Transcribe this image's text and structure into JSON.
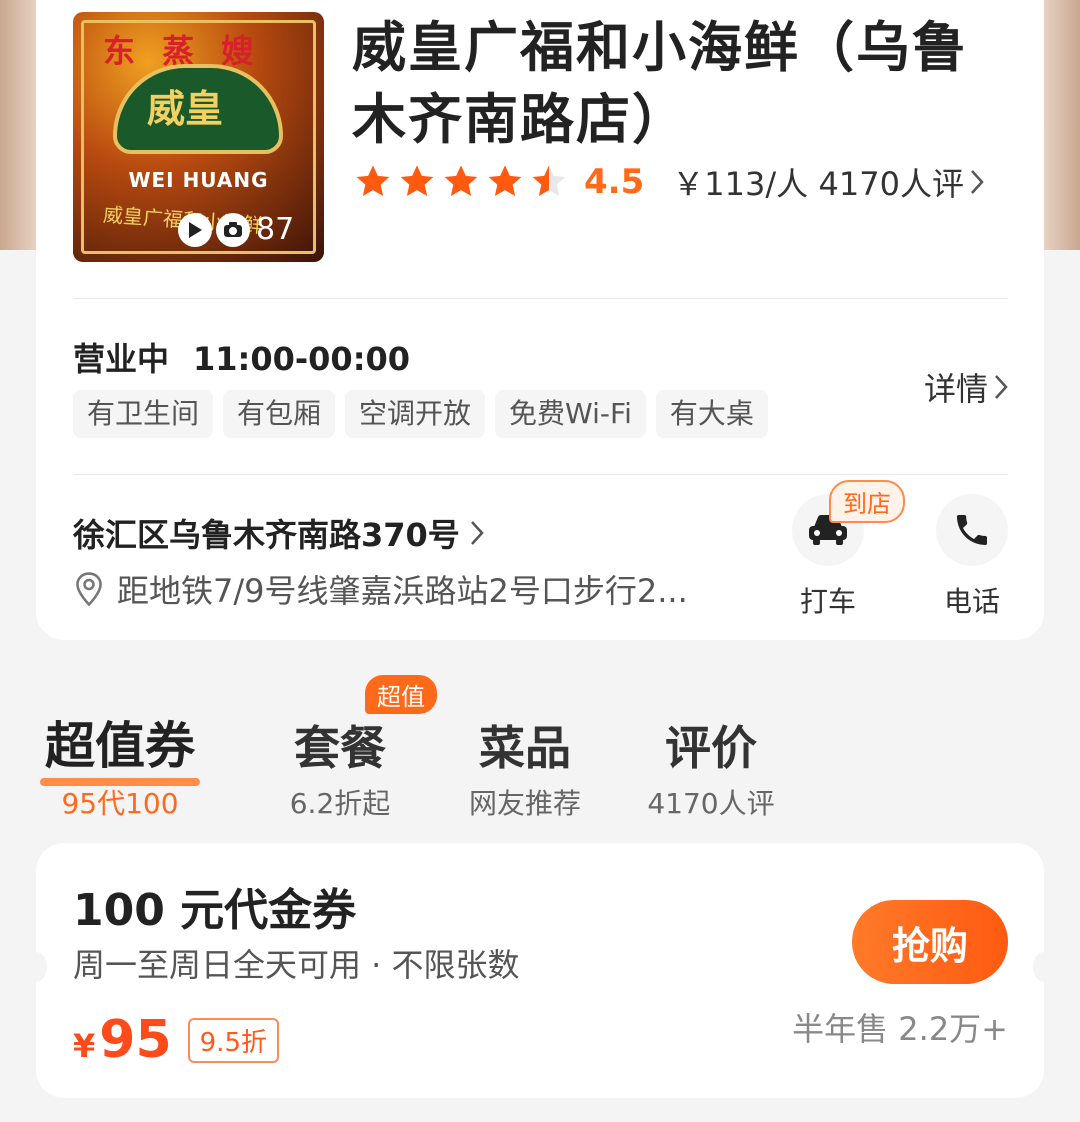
{
  "shop": {
    "cover": {
      "top_text": "东 蒸 嫂",
      "logo_text": "威皇",
      "logo_en": "WEI HUANG",
      "logo_sub": "威皇广福和小海鲜",
      "media_count": "87"
    },
    "title": "威皇广福和小海鲜（乌鲁木齐南路店）",
    "rating": 4.5,
    "rating_text": "4.5",
    "price_per_person": "￥113/人",
    "review_count": "4170人评"
  },
  "business": {
    "status": "营业中",
    "hours": "11:00-00:00",
    "tags": [
      "有卫生间",
      "有包厢",
      "空调开放",
      "免费Wi-Fi",
      "有大桌"
    ],
    "details_label": "详情"
  },
  "location": {
    "address": "徐汇区乌鲁木齐南路370号",
    "subway": "距地铁7/9号线肇嘉浜路站2号口步行2...",
    "taxi_badge": "到店",
    "taxi_label": "打车",
    "phone_label": "电话"
  },
  "tabs": [
    {
      "title": "超值券",
      "sub": "95代100",
      "active": true
    },
    {
      "title": "套餐",
      "sub": "6.2折起",
      "active": false
    },
    {
      "title": "菜品",
      "sub": "网友推荐",
      "active": false
    },
    {
      "title": "评价",
      "sub": "4170人评",
      "active": false
    }
  ],
  "tab_badge": "超值",
  "coupon": {
    "title": "100 元代金券",
    "desc": "周一至周日全天可用 · 不限张数",
    "currency": "¥",
    "price": "95",
    "discount": "9.5折",
    "buy_label": "抢购",
    "sold": "半年售 2.2万+"
  },
  "colors": {
    "accent": "#ff6a1a",
    "star": "#ff5a10"
  }
}
